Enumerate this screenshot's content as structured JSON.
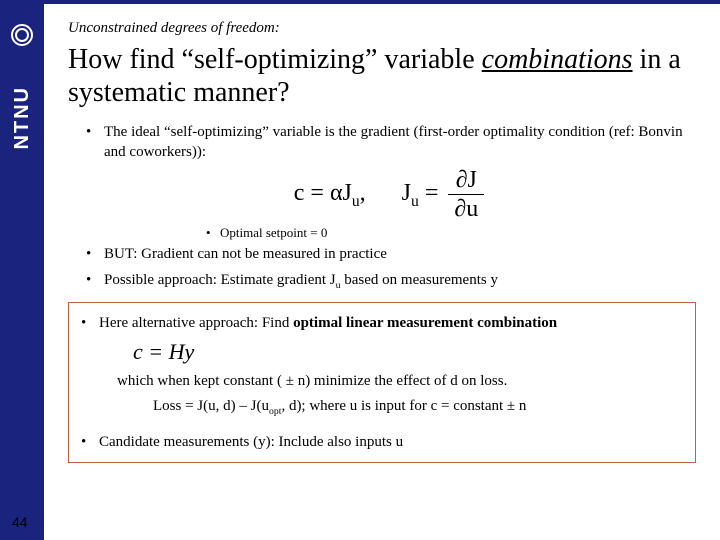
{
  "page_number": "44",
  "pretitle": "Unconstrained degrees of freedom:",
  "title_a": "How find “self-optimizing” variable ",
  "title_combo": "combinations",
  "title_b": " in a systematic manner?",
  "b1": "The ideal “self-optimizing” variable is the gradient (first-order optimality condition (ref: Bonvin and coworkers)):",
  "eq1_lhs": "c = αJ",
  "eq1_sub": "u",
  "eq1_sep": ",",
  "eq1_rhs_a": "J",
  "eq1_rhs_sub": "u",
  "eq1_rhs_eq": " = ",
  "eq1_frac_num": "∂J",
  "eq1_frac_den": "∂u",
  "sub1": "Optimal setpoint = 0",
  "b2": "BUT: Gradient can not be measured in practice",
  "b3_a": "Possible approach: Estimate gradient J",
  "b3_sub": "u",
  "b3_b": " based on measurements y",
  "box_b1_a": "Here alternative approach: Find ",
  "box_b1_b": "optimal linear measurement combination",
  "box_eq": "c = Hy",
  "box_line1": "which when kept constant ( ± n) minimize the effect of d on loss.",
  "box_line2_a": "Loss = J(u, d) – J(u",
  "box_line2_sub": "opt",
  "box_line2_b": ", d);  where u is input for c = constant ± n",
  "box_b2": "Candidate measurements (y): Include also inputs u",
  "sidebar_text": "NTNU"
}
